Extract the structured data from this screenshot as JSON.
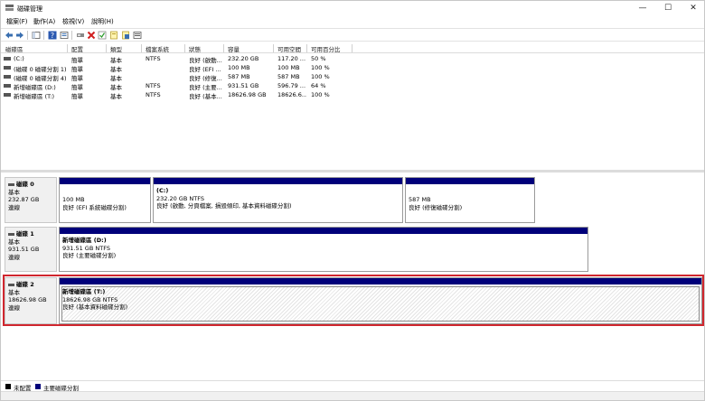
{
  "window": {
    "title": "磁碟管理"
  },
  "menu": [
    "檔案(F)",
    "動作(A)",
    "檢視(V)",
    "說明(H)"
  ],
  "volume_list": {
    "columns": [
      "磁碟區",
      "配置",
      "類型",
      "檔案系統",
      "狀態",
      "容量",
      "可用空間",
      "可用百分比"
    ],
    "rows": [
      [
        "(C:)",
        "簡單",
        "基本",
        "NTFS",
        "良好 (啟動...",
        "232.20 GB",
        "117.20 ...",
        "50 %"
      ],
      [
        "(磁碟 0 磁碟分割 1)",
        "簡單",
        "基本",
        "",
        "良好 (EFI ...",
        "100 MB",
        "100 MB",
        "100 %"
      ],
      [
        "(磁碟 0 磁碟分割 4)",
        "簡單",
        "基本",
        "",
        "良好 (修復...",
        "587 MB",
        "587 MB",
        "100 %"
      ],
      [
        "新增磁碟區 (D:)",
        "簡單",
        "基本",
        "NTFS",
        "良好 (主要...",
        "931.51 GB",
        "596.79 ...",
        "64 %"
      ],
      [
        "新增磁碟區 (T:)",
        "簡單",
        "基本",
        "NTFS",
        "良好 (基本...",
        "18626.98 GB",
        "18626.6...",
        "100 %"
      ]
    ]
  },
  "disks": [
    {
      "name": "磁碟 0",
      "type": "基本",
      "size": "232.87 GB",
      "status": "連線",
      "partitions": [
        {
          "name": "",
          "line1": "100 MB",
          "line2": "良好 (EFI 系統磁碟分割)"
        },
        {
          "name": "(C:)",
          "line1": "232.20 GB NTFS",
          "line2": "良好 (啟動, 分頁檔案, 損毀傾印, 基本資料磁碟分割)"
        },
        {
          "name": "",
          "line1": "587 MB",
          "line2": "良好 (修復磁碟分割)"
        }
      ]
    },
    {
      "name": "磁碟 1",
      "type": "基本",
      "size": "931.51 GB",
      "status": "連線",
      "partitions": [
        {
          "name": "新增磁碟區 (D:)",
          "line1": "931.51 GB NTFS",
          "line2": "良好 (主要磁碟分割)"
        }
      ]
    },
    {
      "name": "磁碟 2",
      "type": "基本",
      "size": "18626.98 GB",
      "status": "連線",
      "partitions": [
        {
          "name": "新增磁碟區 (T:)",
          "line1": "18626.98 GB NTFS",
          "line2": "良好 (基本資料磁碟分割)"
        }
      ]
    }
  ],
  "legend": [
    {
      "label": "未配置",
      "color": "#000000"
    },
    {
      "label": "主要磁碟分割",
      "color": "#00007a"
    }
  ],
  "colors": {
    "partition_bar": "#00007a",
    "selection_outline": "#d0262e"
  },
  "toolbar_icons": [
    "back-arrow-icon",
    "forward-arrow-icon",
    "console-tree-icon",
    "help-icon",
    "properties-icon",
    "refresh-icon",
    "delete-icon",
    "check-icon",
    "rescan-icon",
    "export-icon",
    "list-icon"
  ]
}
